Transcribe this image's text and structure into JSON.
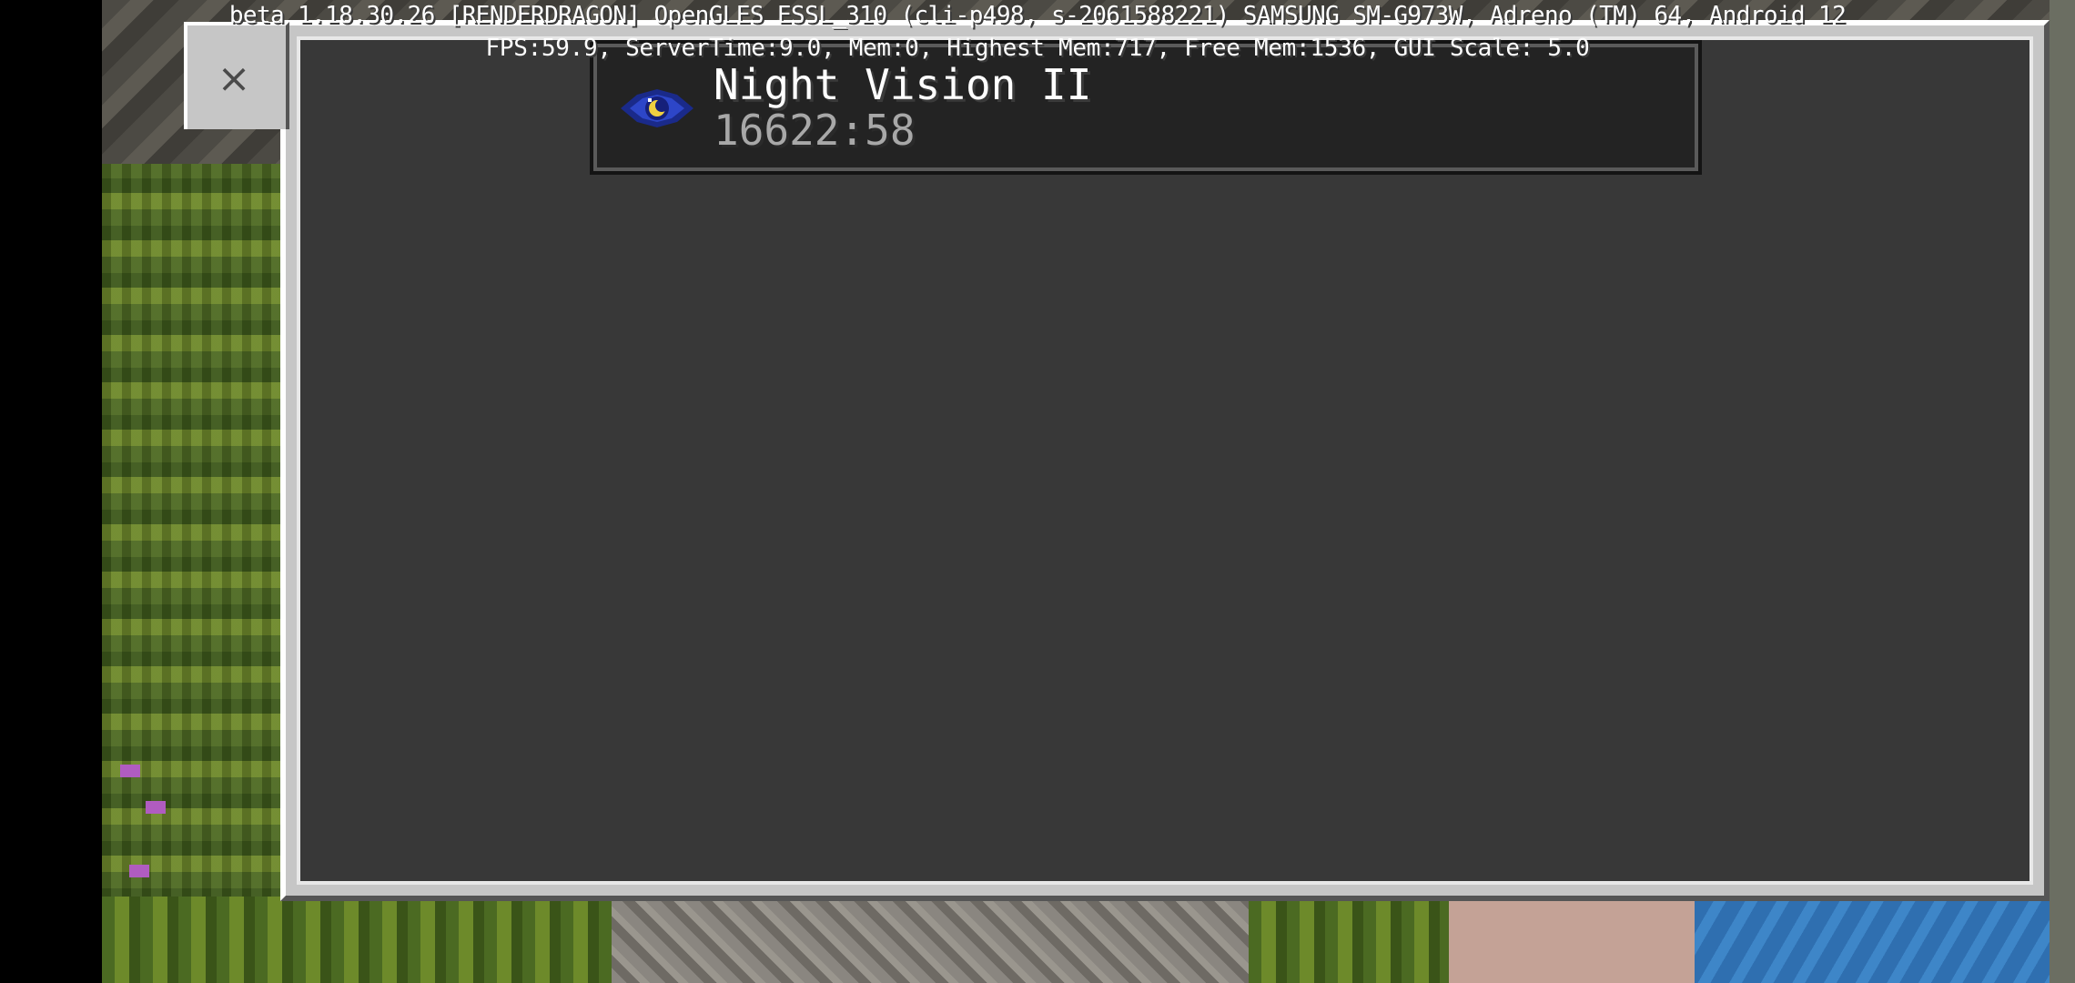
{
  "debug": {
    "line1": "beta 1.18.30.26 [RENDERDRAGON] OpenGLES ESSL_310 (cli-p498, s-2061588221) SAMSUNG SM-G973W, Adreno (TM) 64, Android 12",
    "line2": "FPS:59.9, ServerTime:9.0, Mem:0, Highest Mem:717, Free Mem:1536, GUI Scale: 5.0"
  },
  "close_button": {
    "icon": "close-icon",
    "glyph": "×"
  },
  "effects": [
    {
      "name": "Night Vision II",
      "duration": "16622:58",
      "icon": "night-vision-eye-icon"
    }
  ],
  "colors": {
    "panel": "#c6c6c6",
    "panel_inner": "#383838",
    "card": "#232323",
    "effect_name": "#ffffff",
    "effect_time": "#a8a8a8"
  }
}
